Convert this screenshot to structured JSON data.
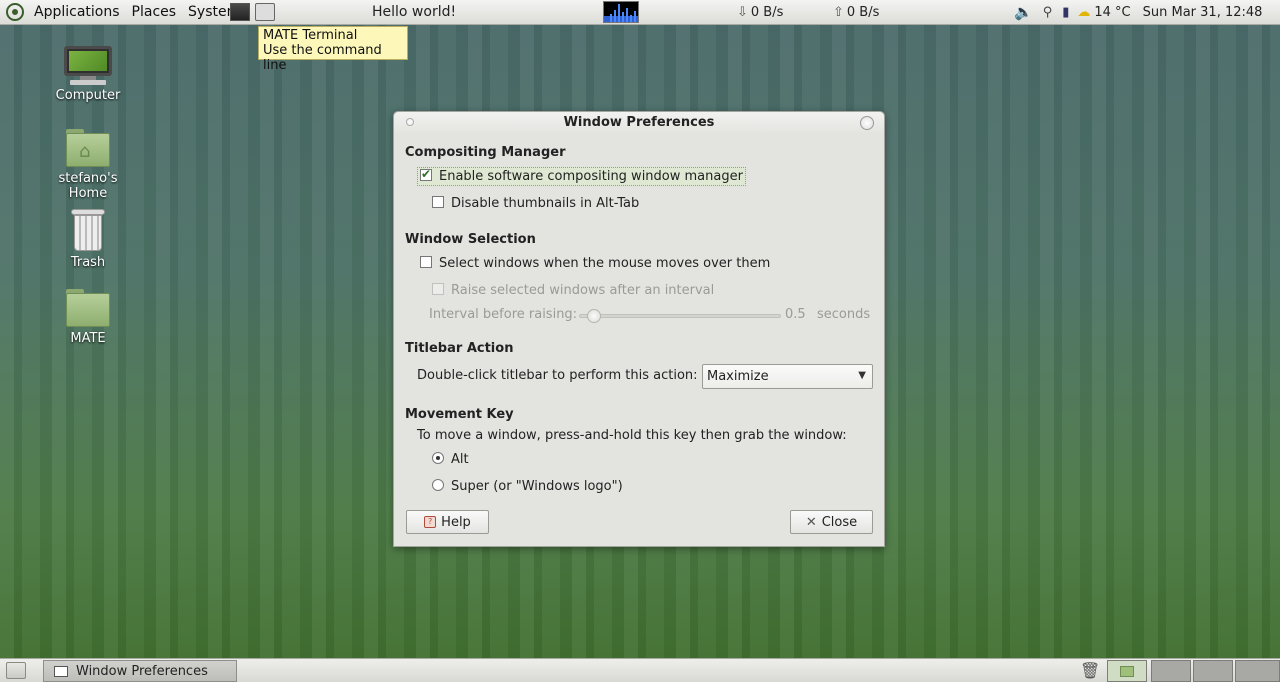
{
  "top_panel": {
    "menus": [
      "Applications",
      "Places",
      "System"
    ],
    "window_title": "Hello world!",
    "net_down": "0 B/s",
    "net_up": "0 B/s",
    "weather": "14 °C",
    "clock": "Sun Mar 31, 12:48"
  },
  "tooltip": {
    "line1": "MATE Terminal",
    "line2": "Use the command line"
  },
  "desktop": {
    "computer_label": "Computer",
    "home_label_1": "stefano's",
    "home_label_2": "Home",
    "trash_label": "Trash",
    "folder_label": "MATE"
  },
  "dialog": {
    "title": "Window Preferences",
    "compositing": {
      "heading": "Compositing Manager",
      "enable_label": "Enable software compositing window manager",
      "enable_checked": true,
      "thumbs_label": "Disable thumbnails in Alt-Tab",
      "thumbs_checked": false
    },
    "selection": {
      "heading": "Window Selection",
      "select_label": "Select windows when the mouse moves over them",
      "raise_label": "Raise selected windows after an interval",
      "interval_label": "Interval before raising:",
      "interval_value": "0.5",
      "interval_unit": "seconds"
    },
    "titlebar": {
      "heading": "Titlebar Action",
      "action_label": "Double-click titlebar to perform this action:",
      "action_value": "Maximize"
    },
    "movement": {
      "heading": "Movement Key",
      "desc": "To move a window, press-and-hold this key then grab the window:",
      "option_alt": "Alt",
      "option_super": "Super (or \"Windows logo\")",
      "selected": "Alt"
    },
    "help_label": "Help",
    "close_label": "Close"
  },
  "bottom_panel": {
    "task_label": "Window Preferences"
  }
}
